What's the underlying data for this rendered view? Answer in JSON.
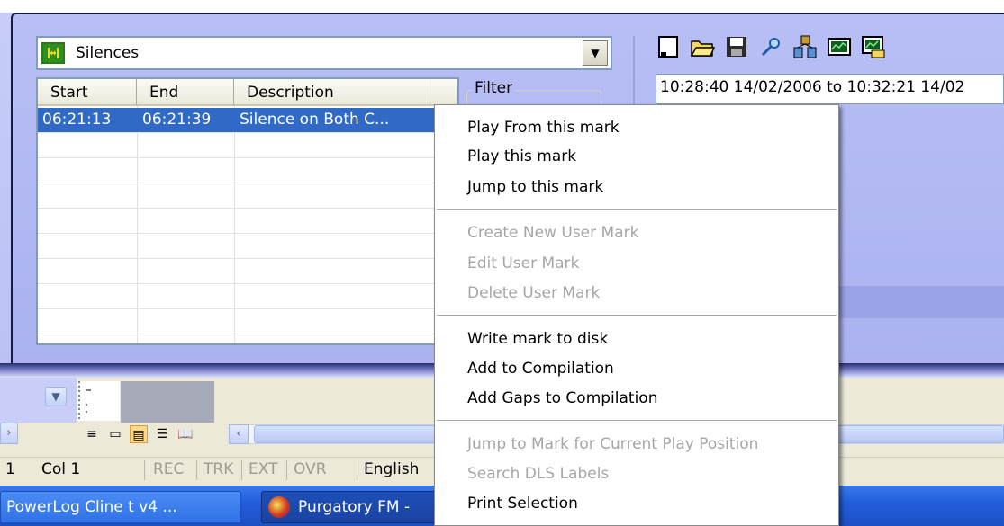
{
  "dropdown": {
    "value": "Silences"
  },
  "list": {
    "columns": [
      "Start",
      "End",
      "Description"
    ],
    "rows": [
      {
        "start": "06:21:13",
        "end": "06:21:39",
        "description": "Silence on Both C..."
      }
    ]
  },
  "filter": {
    "label": "Filter"
  },
  "range": {
    "text": "10:28:40 14/02/2006 to 10:32:21 14/02"
  },
  "toolbar": {
    "icons": [
      "new-icon",
      "open-folder-icon",
      "save-icon",
      "search-icon",
      "network-icon",
      "chart-icon",
      "export-chart-icon"
    ]
  },
  "context_menu": {
    "items": [
      {
        "label": "Play From this mark",
        "enabled": true
      },
      {
        "label": "Play this mark",
        "enabled": true
      },
      {
        "label": "Jump to this mark",
        "enabled": true
      },
      {
        "label": "Create New User Mark",
        "enabled": false
      },
      {
        "label": "Edit User Mark",
        "enabled": false
      },
      {
        "label": "Delete User Mark",
        "enabled": false
      },
      {
        "label": "Write mark to disk",
        "enabled": true
      },
      {
        "label": "Add to Compilation",
        "enabled": true
      },
      {
        "label": "Add Gaps to Compilation",
        "enabled": true
      },
      {
        "label": "Jump to Mark for Current Play Position",
        "enabled": false
      },
      {
        "label": "Search DLS Labels",
        "enabled": false
      },
      {
        "label": "Print Selection",
        "enabled": true
      }
    ]
  },
  "status_bar": {
    "line": "1",
    "col": "Col 1",
    "rec": "REC",
    "trk": "TRK",
    "ext": "EXT",
    "ovr": "OVR",
    "language": "English"
  },
  "taskbar": {
    "items": [
      {
        "label": "PowerLog Cline t v4 ..."
      },
      {
        "label": "Purgatory FM -"
      }
    ]
  },
  "colors": {
    "selection": "#3169c6",
    "panel": "#b4bcf3",
    "taskbar": "#245edb",
    "disabled_text": "#a7a6a6"
  }
}
